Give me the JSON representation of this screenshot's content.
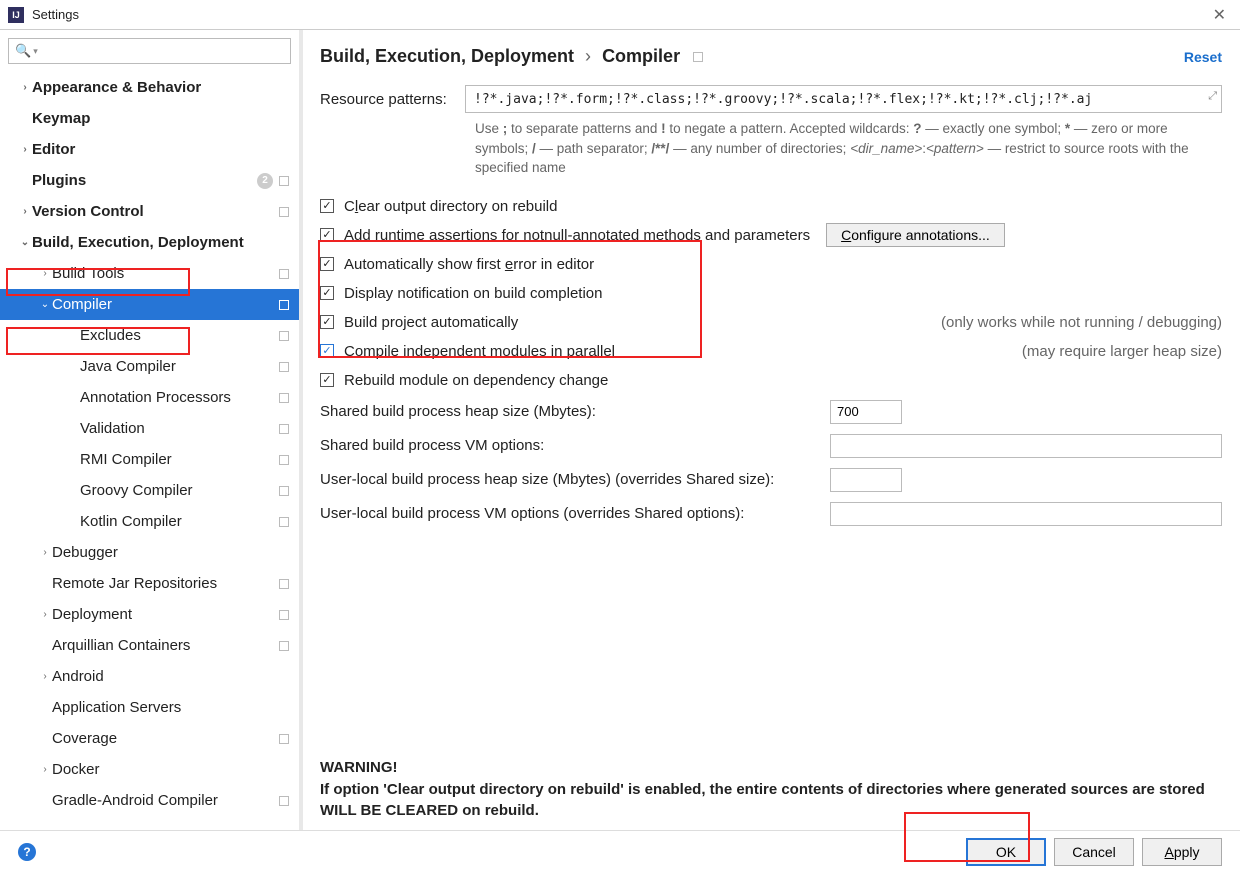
{
  "window": {
    "title": "Settings",
    "close": "✕"
  },
  "tree": [
    {
      "label": "Appearance & Behavior",
      "level": 0,
      "arrow": "›"
    },
    {
      "label": "Keymap",
      "level": 0,
      "arrow": ""
    },
    {
      "label": "Editor",
      "level": 0,
      "arrow": "›"
    },
    {
      "label": "Plugins",
      "level": 0,
      "arrow": "",
      "badge": "2",
      "sq": true
    },
    {
      "label": "Version Control",
      "level": 0,
      "arrow": "›",
      "sq": true
    },
    {
      "label": "Build, Execution, Deployment",
      "level": 0,
      "arrow": "⌄"
    },
    {
      "label": "Build Tools",
      "level": 1,
      "arrow": "›",
      "sq": true
    },
    {
      "label": "Compiler",
      "level": 1,
      "arrow": "⌄",
      "selected": true,
      "sq": true
    },
    {
      "label": "Excludes",
      "level": 2,
      "arrow": "",
      "sq": true
    },
    {
      "label": "Java Compiler",
      "level": 2,
      "arrow": "",
      "sq": true
    },
    {
      "label": "Annotation Processors",
      "level": 2,
      "arrow": "",
      "sq": true
    },
    {
      "label": "Validation",
      "level": 2,
      "arrow": "",
      "sq": true
    },
    {
      "label": "RMI Compiler",
      "level": 2,
      "arrow": "",
      "sq": true
    },
    {
      "label": "Groovy Compiler",
      "level": 2,
      "arrow": "",
      "sq": true
    },
    {
      "label": "Kotlin Compiler",
      "level": 2,
      "arrow": "",
      "sq": true
    },
    {
      "label": "Debugger",
      "level": 1,
      "arrow": "›"
    },
    {
      "label": "Remote Jar Repositories",
      "level": 1,
      "arrow": "",
      "sq": true
    },
    {
      "label": "Deployment",
      "level": 1,
      "arrow": "›",
      "sq": true
    },
    {
      "label": "Arquillian Containers",
      "level": 1,
      "arrow": "",
      "sq": true
    },
    {
      "label": "Android",
      "level": 1,
      "arrow": "›"
    },
    {
      "label": "Application Servers",
      "level": 1,
      "arrow": ""
    },
    {
      "label": "Coverage",
      "level": 1,
      "arrow": "",
      "sq": true
    },
    {
      "label": "Docker",
      "level": 1,
      "arrow": "›"
    },
    {
      "label": "Gradle-Android Compiler",
      "level": 1,
      "arrow": "",
      "sq": true
    }
  ],
  "breadcrumb": {
    "parent": "Build, Execution, Deployment",
    "child": "Compiler"
  },
  "reset": "Reset",
  "resource": {
    "label": "Resource patterns:",
    "value": "!?*.java;!?*.form;!?*.class;!?*.groovy;!?*.scala;!?*.flex;!?*.kt;!?*.clj;!?*.aj"
  },
  "helpPrefix": "Use ",
  "helpSemi": ";",
  "helpA": " to separate patterns and ",
  "helpBang": "!",
  "helpB": " to negate a pattern. Accepted wildcards: ",
  "helpQ": "?",
  "helpC": " — exactly one symbol; ",
  "helpStar": "*",
  "helpD": " — zero or more symbols; ",
  "helpSlash": "/",
  "helpE": " — path separator; ",
  "helpDStar": "/**/",
  "helpF": " — any number of directories; ",
  "helpDir": "<dir_name>",
  "helpColon": ":",
  "helpPat": "<pattern>",
  "helpG": " — restrict to source roots with the specified name",
  "chk": {
    "clear": "Clear output directory on rebuild",
    "runtime": "Add runtime assertions for notnull-annotated methods and parameters",
    "config": "Configure annotations...",
    "auto_err": "Automatically show first error in editor",
    "notify": "Display notification on build completion",
    "build_auto": "Build project automatically",
    "build_auto_hint": "(only works while not running / debugging)",
    "parallel": "Compile independent modules in parallel",
    "parallel_hint": "(may require larger heap size)",
    "rebuild": "Rebuild module on dependency change"
  },
  "fields": {
    "heap": {
      "label": "Shared build process heap size (Mbytes):",
      "value": "700"
    },
    "vm": {
      "label": "Shared build process VM options:",
      "value": ""
    },
    "local_heap": {
      "label": "User-local build process heap size (Mbytes) (overrides Shared size):",
      "value": ""
    },
    "local_vm": {
      "label": "User-local build process VM options (overrides Shared options):",
      "value": ""
    }
  },
  "warning": {
    "title": "WARNING!",
    "body": "If option 'Clear output directory on rebuild' is enabled, the entire contents of directories where generated sources are stored WILL BE CLEARED on rebuild."
  },
  "footer": {
    "ok": "OK",
    "cancel": "Cancel",
    "apply": "Apply"
  }
}
